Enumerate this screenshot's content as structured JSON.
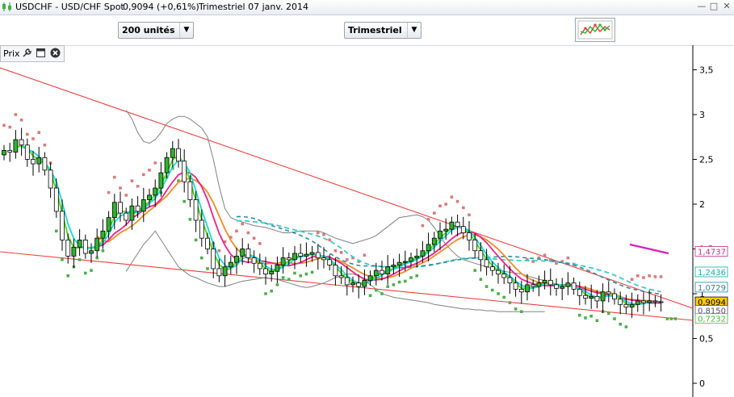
{
  "window": {
    "symbol": "USDCHF - USD/CHF Spot",
    "price_text": "0,9094 (+0,61%)",
    "period_text": "Trimestriel  07 janv. 2014"
  },
  "toolbar": {
    "units_select": "200 unités",
    "period_select": "Trimestriel"
  },
  "panel": {
    "label": "Prix"
  },
  "colors": {
    "up_candle": "#2fb32f",
    "down_candle": "#ffffff",
    "bollinger": "#808080",
    "ma_cyan": "#19d7d7",
    "ma_green": "#55dd22",
    "ma_pink": "#e8248a",
    "ma_orange": "#f08a26",
    "ma_dash_cyan": "#39c9c9",
    "ma_dash_teal": "#2a8aa0",
    "trend": "#e8403c",
    "sar_up": "#d97a7a",
    "sar_down": "#4cae4c",
    "last_price": "#ffcc00"
  },
  "chart_data": {
    "type": "candlestick",
    "y_axis": {
      "min": 0,
      "max": 3.7,
      "ticks": [
        "0",
        "0,5",
        "1",
        "1,5",
        "2",
        "2,5",
        "3",
        "3,5"
      ],
      "tick_values": [
        0,
        0.5,
        1.0,
        1.5,
        2.0,
        2.5,
        3.0,
        3.5
      ]
    },
    "price_labels": [
      {
        "text": "1,4737",
        "value": 1.4737,
        "color": "#c0308a",
        "bg": "#ffffff"
      },
      {
        "text": "1,2436",
        "value": 1.2436,
        "color": "#1aa9a9",
        "bg": "#ffffff"
      },
      {
        "text": "1,0729",
        "value": 1.0729,
        "color": "#2a7f9a",
        "bg": "#ffffff"
      },
      {
        "text": "0,9094",
        "value": 0.9094,
        "color": "#000000",
        "bg": "#ffcc00"
      },
      {
        "text": "0,8150",
        "value": 0.815,
        "color": "#555555",
        "bg": "#ffffff"
      },
      {
        "text": "0,7232",
        "value": 0.7232,
        "color": "#4cae4c",
        "bg": "#ffffff"
      }
    ],
    "closes": [
      2.6,
      2.58,
      2.72,
      2.66,
      2.5,
      2.45,
      2.52,
      2.38,
      2.18,
      1.92,
      1.6,
      1.42,
      1.52,
      1.6,
      1.45,
      1.48,
      1.62,
      1.7,
      1.85,
      2.02,
      1.9,
      1.82,
      1.98,
      1.92,
      2.05,
      2.1,
      2.18,
      2.35,
      2.52,
      2.62,
      2.48,
      2.25,
      2.05,
      1.82,
      1.62,
      1.5,
      1.28,
      1.2,
      1.3,
      1.35,
      1.42,
      1.5,
      1.4,
      1.34,
      1.28,
      1.22,
      1.25,
      1.32,
      1.4,
      1.38,
      1.45,
      1.42,
      1.44,
      1.46,
      1.4,
      1.38,
      1.32,
      1.2,
      1.18,
      1.1,
      1.12,
      1.08,
      1.15,
      1.2,
      1.26,
      1.22,
      1.3,
      1.32,
      1.35,
      1.36,
      1.4,
      1.42,
      1.48,
      1.55,
      1.62,
      1.7,
      1.72,
      1.8,
      1.75,
      1.68,
      1.6,
      1.48,
      1.38,
      1.3,
      1.26,
      1.22,
      1.18,
      1.12,
      1.05,
      1.02,
      1.1,
      1.08,
      1.12,
      1.15,
      1.1,
      1.06,
      1.08,
      1.12,
      1.05,
      0.98,
      0.95,
      0.97,
      0.92,
      1.02,
      1.0,
      0.94,
      0.88,
      0.85,
      0.88,
      0.92,
      0.9,
      0.92,
      0.91,
      0.9094
    ],
    "bollinger_upper": [
      null,
      null,
      null,
      null,
      null,
      null,
      null,
      null,
      null,
      null,
      null,
      null,
      null,
      null,
      null,
      null,
      null,
      null,
      null,
      null,
      null,
      3.05,
      2.95,
      2.8,
      2.7,
      2.68,
      2.72,
      2.8,
      2.9,
      2.95,
      2.98,
      2.98,
      2.95,
      2.9,
      2.85,
      2.75,
      2.5,
      2.2,
      1.95,
      1.85,
      1.82,
      1.8,
      1.78,
      1.76,
      1.75,
      1.74,
      1.72,
      1.7,
      1.68,
      1.68,
      1.69,
      1.7,
      1.7,
      1.7,
      1.7,
      1.68,
      1.65,
      1.62,
      1.6,
      1.58,
      1.56,
      1.58,
      1.6,
      1.62,
      1.65,
      1.7,
      1.75,
      1.8,
      1.85,
      1.86,
      1.87,
      1.88,
      1.86,
      1.82,
      1.74,
      1.64,
      1.55,
      1.48,
      1.42,
      1.38,
      1.36,
      1.34,
      1.32,
      1.3,
      1.28,
      1.26,
      1.25,
      1.24,
      1.23,
      1.22,
      1.2,
      1.18,
      1.16,
      1.15
    ],
    "bollinger_lower": [
      null,
      null,
      null,
      null,
      null,
      null,
      null,
      null,
      null,
      null,
      null,
      null,
      null,
      null,
      null,
      null,
      null,
      null,
      null,
      null,
      null,
      1.25,
      1.35,
      1.45,
      1.55,
      1.62,
      1.7,
      1.6,
      1.5,
      1.4,
      1.3,
      1.25,
      1.2,
      1.18,
      1.15,
      1.12,
      1.1,
      1.08,
      1.08,
      1.1,
      1.12,
      1.14,
      1.15,
      1.16,
      1.17,
      1.18,
      1.17,
      1.16,
      1.14,
      1.12,
      1.1,
      1.08,
      1.07,
      1.08,
      1.1,
      1.12,
      1.15,
      1.18,
      1.2,
      1.22,
      1.22,
      1.2,
      1.15,
      1.1,
      1.05,
      1.0,
      0.98,
      0.96,
      0.95,
      0.94,
      0.93,
      0.92,
      0.91,
      0.9,
      0.88,
      0.87,
      0.86,
      0.85,
      0.84,
      0.83,
      0.83,
      0.82,
      0.82,
      0.81,
      0.81,
      0.8,
      0.8,
      0.8,
      0.8,
      0.8,
      0.8,
      0.8,
      0.8,
      0.8
    ]
  }
}
